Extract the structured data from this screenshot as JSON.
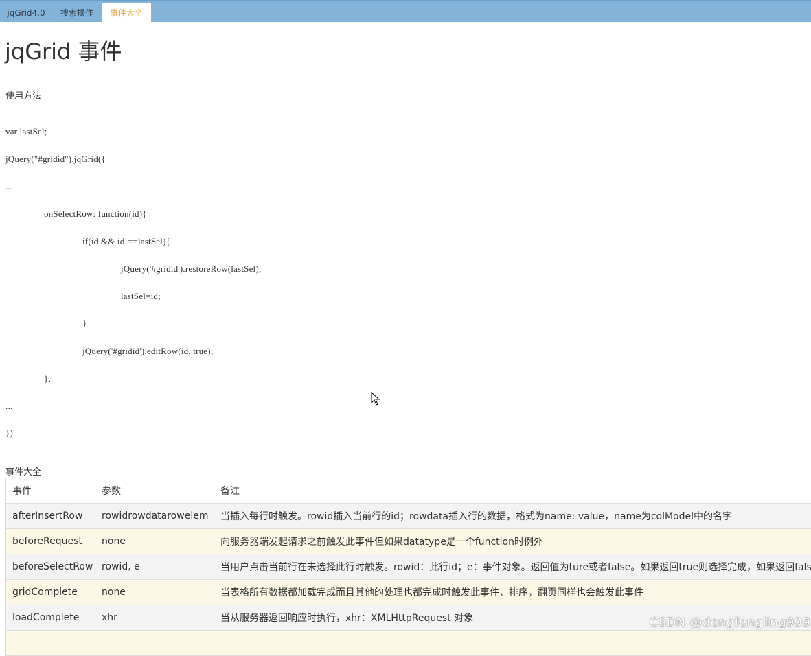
{
  "tabs": [
    {
      "label": "jqGrid4.0",
      "active": false
    },
    {
      "label": "搜索操作",
      "active": false
    },
    {
      "label": "事件大全",
      "active": true
    }
  ],
  "colors": {
    "tabbar": "#83b3d9",
    "active_tab_text": "#e8a33a",
    "even_row": "#fcf8e5",
    "odd_row": "#f3f3f3"
  },
  "page_title": "jqGrid 事件",
  "usage_label": "使用方法",
  "code_lines": [
    "var lastSel;",
    "jQuery(\"#gridid\").jqGrid({",
    "...",
    "onSelectRow: function(id){",
    "if(id && id!==lastSel){",
    "jQuery('#gridid').restoreRow(lastSel);",
    "lastSel=id;",
    "}",
    "jQuery('#gridid').editRow(id, true);",
    "},",
    "...",
    "})"
  ],
  "events_label": "事件大全",
  "table": {
    "headers": [
      "事件",
      "参数",
      "备注"
    ],
    "rows": [
      [
        "afterInsertRow",
        "rowidrowdatarowelem",
        "当插入每行时触发。rowid插入当前行的id；rowdata插入行的数据，格式为name: value，name为colModel中的名字"
      ],
      [
        "beforeRequest",
        "none",
        "向服务器端发起请求之前触发此事件但如果datatype是一个function时例外"
      ],
      [
        "beforeSelectRow",
        "rowid, e",
        "当用户点击当前行在未选择此行时触发。rowid：此行id；e：事件对象。返回值为ture或者false。如果返回true则选择完成，如果返回false则不会"
      ],
      [
        "gridComplete",
        "none",
        "当表格所有数据都加载完成而且其他的处理也都完成时触发此事件，排序，翻页同样也会触发此事件"
      ],
      [
        "loadComplete",
        "xhr",
        "当从服务器返回响应时执行，xhr：XMLHttpRequest 对象"
      ],
      [
        "",
        "",
        ""
      ]
    ]
  },
  "watermark": "CSDN @dengfengling999",
  "icons": {
    "cursor": "arrow-cursor-icon"
  }
}
